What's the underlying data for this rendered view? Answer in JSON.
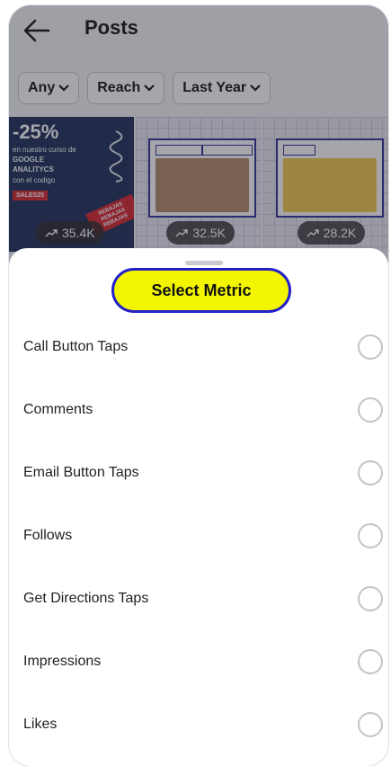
{
  "header": {
    "title": "Posts"
  },
  "filters": [
    {
      "label": "Any"
    },
    {
      "label": "Reach"
    },
    {
      "label": "Last Year"
    }
  ],
  "thumbnails": [
    {
      "views": "35.4K",
      "promo": {
        "percent": "-25%",
        "line1": "en nuestro curso de",
        "line2": "GOOGLE",
        "line3": "ANALITYCS",
        "line4": "con el codigo",
        "code": "SALES25",
        "tag": "REBAJAS REBAJAS REBAJAS"
      }
    },
    {
      "views": "32.5K"
    },
    {
      "views": "28.2K"
    }
  ],
  "sheet": {
    "title": "Select Metric",
    "metrics": [
      {
        "label": "Call Button Taps"
      },
      {
        "label": "Comments"
      },
      {
        "label": "Email Button Taps"
      },
      {
        "label": "Follows"
      },
      {
        "label": "Get Directions Taps"
      },
      {
        "label": "Impressions"
      },
      {
        "label": "Likes"
      }
    ]
  },
  "colors": {
    "title_highlight": "#f3f600",
    "title_border": "#2320c8"
  },
  "icons": [
    "back-arrow-icon",
    "chevron-down-icon",
    "trending-up-icon"
  ]
}
